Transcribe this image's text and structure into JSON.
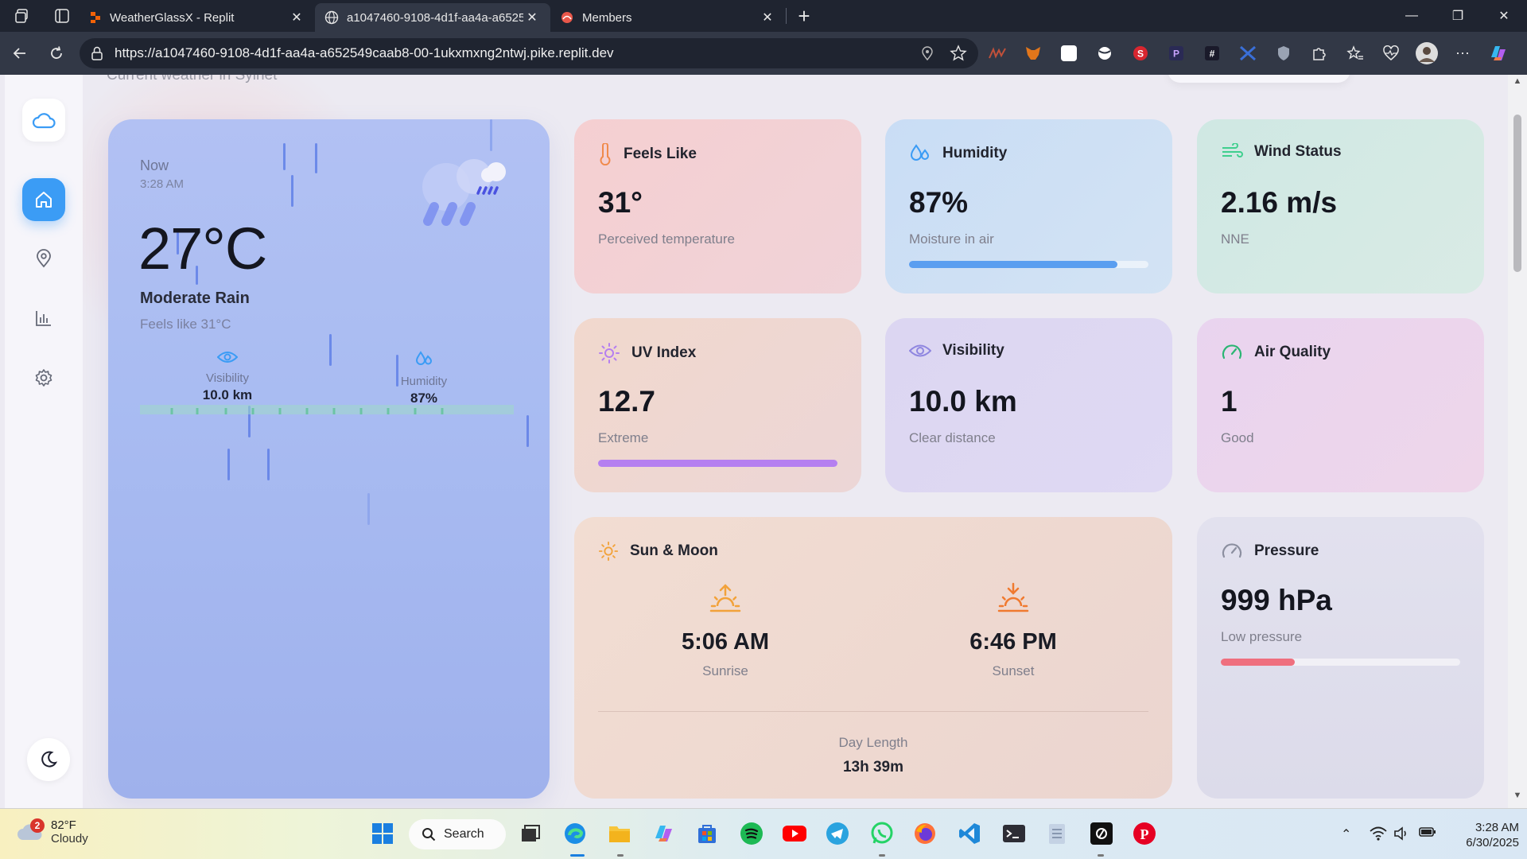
{
  "browser": {
    "tabs": [
      {
        "title": "WeatherGlassX - Replit",
        "active": false
      },
      {
        "title": "a1047460-9108-4d1f-aa4a-a6525",
        "active": true
      },
      {
        "title": "Members",
        "active": false
      }
    ],
    "url": "https://a1047460-9108-4d1f-aa4a-a652549caab8-00-1ukxmxng2ntwj.pike.replit.dev"
  },
  "page": {
    "subtitle": "Current weather in Sylhet"
  },
  "current": {
    "now_label": "Now",
    "time": "3:28 AM",
    "temperature": "27°C",
    "condition": "Moderate Rain",
    "feels_like": "Feels like 31°C",
    "visibility_label": "Visibility",
    "visibility_value": "10.0 km",
    "humidity_label": "Humidity",
    "humidity_value": "87%"
  },
  "cards": {
    "feels_like": {
      "title": "Feels Like",
      "value": "31°",
      "subtitle": "Perceived temperature"
    },
    "humidity": {
      "title": "Humidity",
      "value": "87%",
      "subtitle": "Moisture in air",
      "bar_fraction": 0.87,
      "bar_color": "#5a9ef0"
    },
    "wind": {
      "title": "Wind Status",
      "value": "2.16 m/s",
      "subtitle": "NNE"
    },
    "uv": {
      "title": "UV Index",
      "value": "12.7",
      "subtitle": "Extreme",
      "bar_fraction": 1.0,
      "bar_color": "#b57ff0"
    },
    "visibility": {
      "title": "Visibility",
      "value": "10.0 km",
      "subtitle": "Clear distance"
    },
    "air_quality": {
      "title": "Air Quality",
      "value": "1",
      "subtitle": "Good"
    },
    "sun_moon": {
      "title": "Sun & Moon",
      "sunrise_time": "5:06 AM",
      "sunrise_label": "Sunrise",
      "sunset_time": "6:46 PM",
      "sunset_label": "Sunset",
      "day_length_label": "Day Length",
      "day_length_value": "13h 39m"
    },
    "pressure": {
      "title": "Pressure",
      "value": "999 hPa",
      "subtitle": "Low pressure",
      "bar_fraction": 0.31,
      "bar_color": "#ef6f7e"
    }
  },
  "taskbar": {
    "weather_temp": "82°F",
    "weather_cond": "Cloudy",
    "notification_count": "2",
    "search_label": "Search",
    "time": "3:28 AM",
    "date": "6/30/2025"
  },
  "colors": {
    "accent": "#3b9cf5",
    "sun_orange": "#f2a23a",
    "sunset_orange": "#f07a30"
  }
}
